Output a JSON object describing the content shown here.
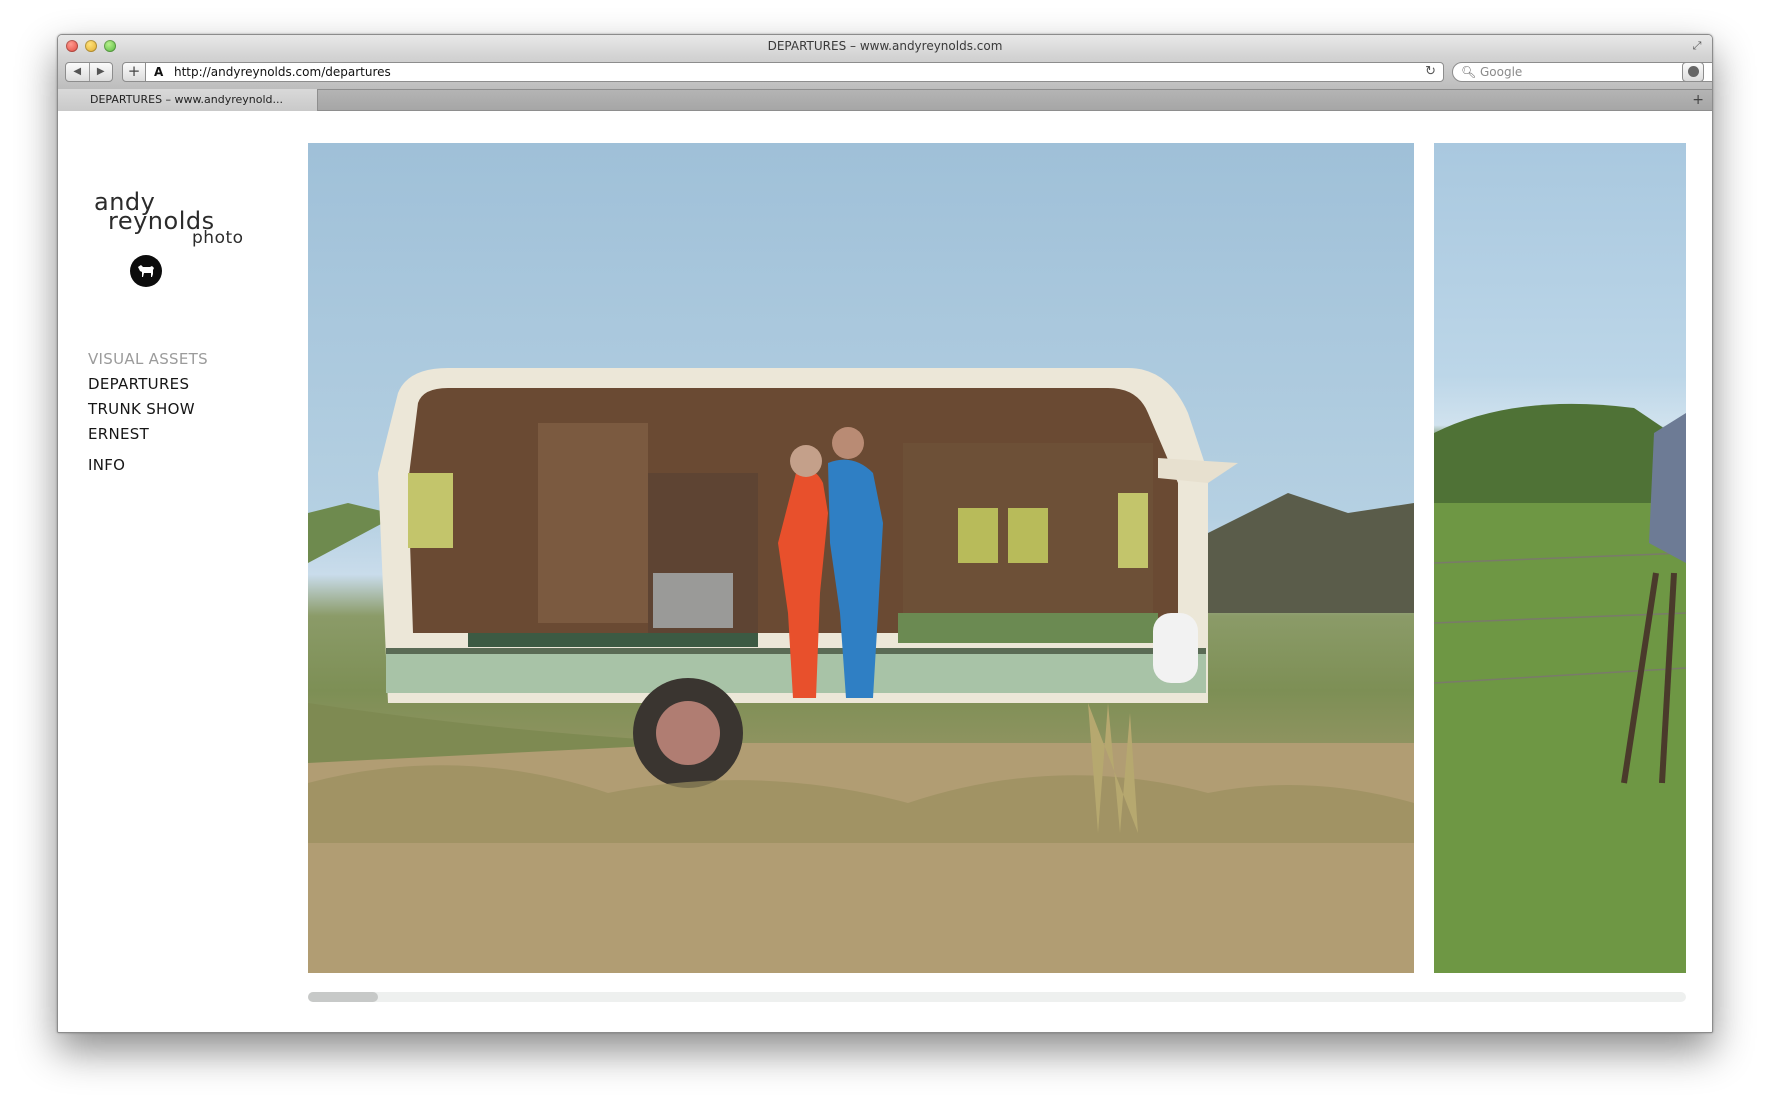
{
  "window": {
    "title": "DEPARTURES – www.andyreynolds.com"
  },
  "toolbar": {
    "back_icon": "◀",
    "forward_icon": "▶",
    "add_icon": "+",
    "url": "http://andyreynolds.com/departures",
    "site_icon": "A",
    "reload_icon": "↻",
    "search_placeholder": "Google",
    "search_icon": "🔍︎"
  },
  "tabs": [
    {
      "label": "DEPARTURES – www.andyreynold..."
    }
  ],
  "newtab_icon": "+",
  "logo": {
    "line1": "andy",
    "line2": "reynolds",
    "line3": "photo"
  },
  "nav": {
    "items": [
      {
        "label": "VISUAL ASSETS"
      },
      {
        "label": "DEPARTURES"
      },
      {
        "label": "TRUNK SHOW"
      },
      {
        "label": "ERNEST"
      },
      {
        "label": "INFO"
      }
    ]
  },
  "gallery": {
    "scroll_position": 0.0
  },
  "colors": {
    "accent_text": "#161616",
    "dim_text": "#9b9b9b",
    "trailer_body": "#ece7d8",
    "trailer_stripe": "#a8c3a7",
    "woman_suit": "#e8502c",
    "man_suit": "#2f7fc4"
  }
}
